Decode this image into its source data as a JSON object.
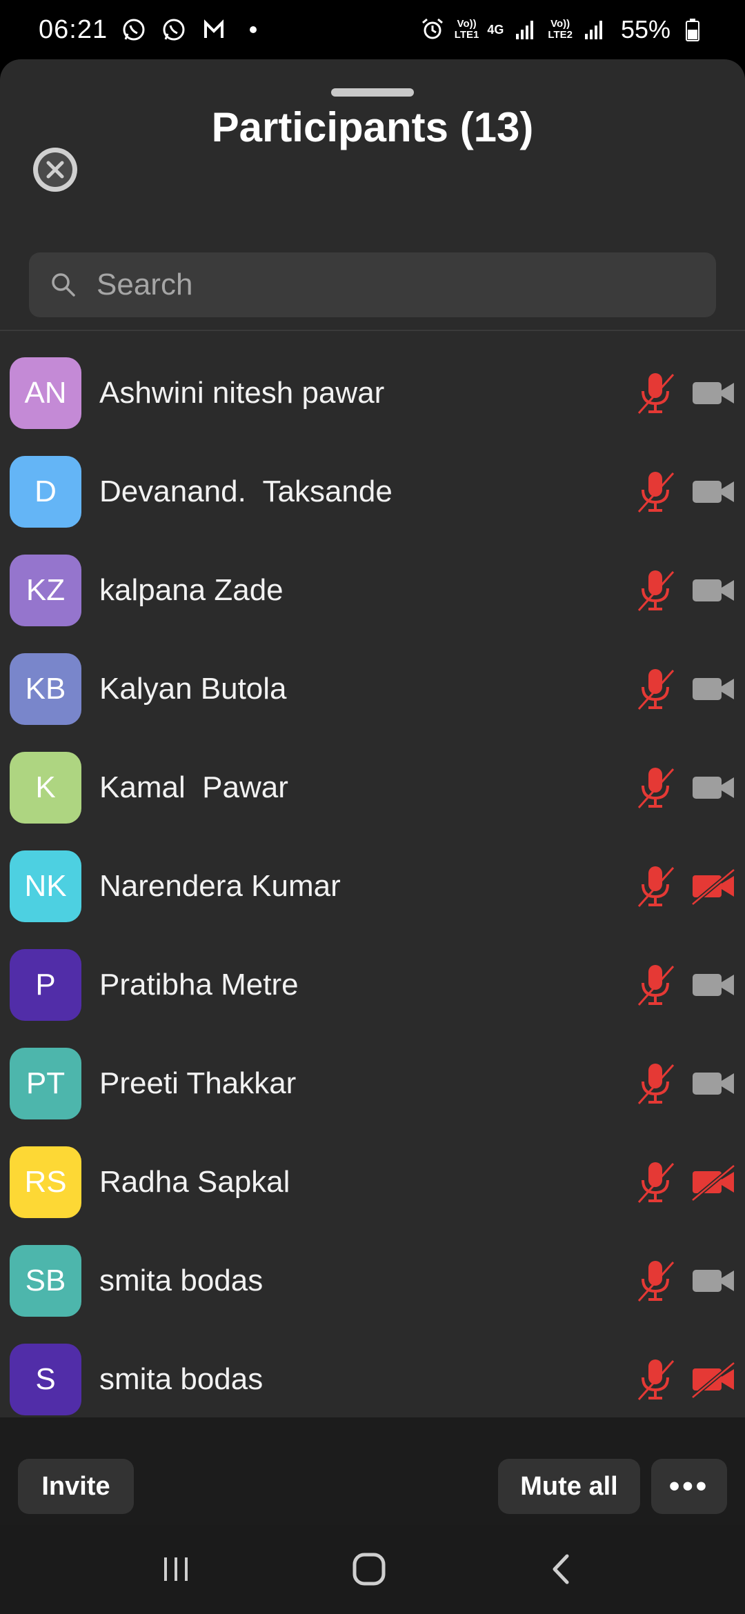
{
  "status_bar": {
    "time": "06:21",
    "sim1_label": "Vo))\nLTE1",
    "sim2_label": "Vo))\nLTE2",
    "network": "4G",
    "battery": "55%"
  },
  "header": {
    "title": "Participants (13)"
  },
  "search": {
    "placeholder": "Search"
  },
  "participants": [
    {
      "initials": "AN",
      "name": "Ashwini nitesh pawar",
      "color": "#c48ad6",
      "mic": "muted",
      "video": "off-gray"
    },
    {
      "initials": "D",
      "name": "Devanand.  Taksande",
      "color": "#64b5f6",
      "mic": "muted",
      "video": "off-gray"
    },
    {
      "initials": "KZ",
      "name": "kalpana Zade",
      "color": "#9575cd",
      "mic": "muted",
      "video": "off-gray"
    },
    {
      "initials": "KB",
      "name": "Kalyan Butola",
      "color": "#7986cb",
      "mic": "muted",
      "video": "off-gray"
    },
    {
      "initials": "K",
      "name": "Kamal  Pawar",
      "color": "#aed581",
      "mic": "muted",
      "video": "off-gray"
    },
    {
      "initials": "NK",
      "name": "Narendera Kumar",
      "color": "#4dd0e1",
      "mic": "muted",
      "video": "off-red"
    },
    {
      "initials": "P",
      "name": "Pratibha Metre",
      "color": "#512da8",
      "mic": "muted",
      "video": "off-gray"
    },
    {
      "initials": "PT",
      "name": "Preeti Thakkar",
      "color": "#4db6ac",
      "mic": "muted",
      "video": "off-gray"
    },
    {
      "initials": "RS",
      "name": "Radha Sapkal",
      "color": "#fdd835",
      "mic": "muted",
      "video": "off-red"
    },
    {
      "initials": "SB",
      "name": "smita bodas",
      "color": "#4db6ac",
      "mic": "muted",
      "video": "off-gray"
    },
    {
      "initials": "S",
      "name": "smita bodas",
      "color": "#512da8",
      "mic": "muted",
      "video": "off-red"
    }
  ],
  "footer": {
    "invite_label": "Invite",
    "mute_all_label": "Mute all",
    "more_label": "•••"
  },
  "colors": {
    "muted_red": "#e53935",
    "camera_gray": "#9e9e9e",
    "sheet_bg": "#2b2b2b"
  }
}
